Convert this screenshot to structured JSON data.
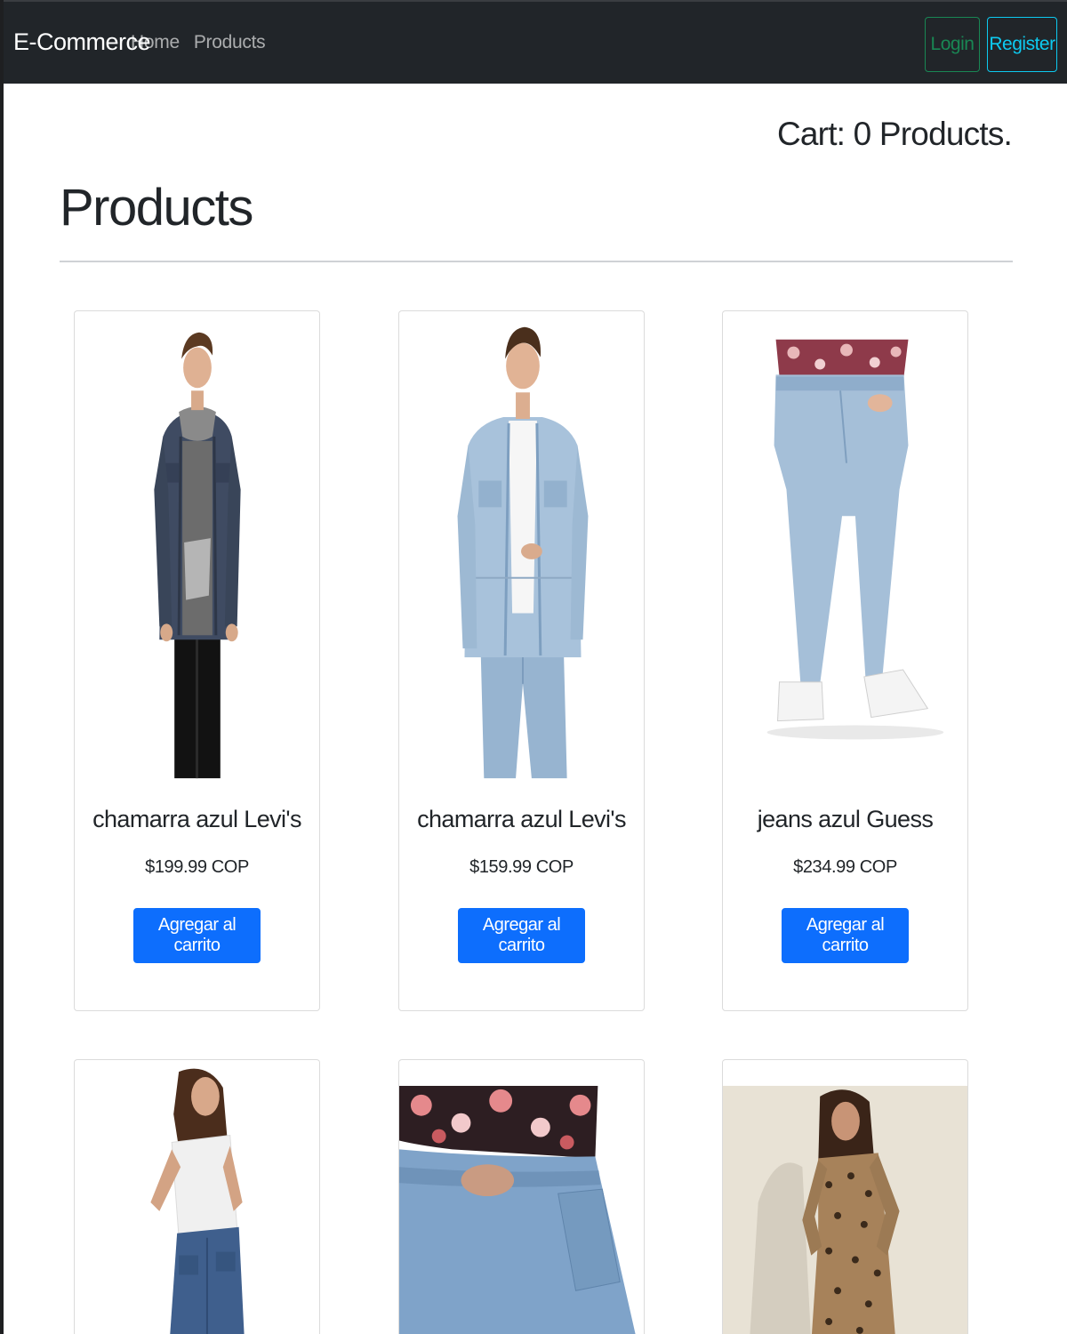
{
  "navbar": {
    "brand": "E-Commerce",
    "links": [
      "Home",
      "Products"
    ],
    "login_label": "Login",
    "register_label": "Register"
  },
  "cart": {
    "text": "Cart: 0 Products."
  },
  "page": {
    "title": "Products"
  },
  "products": [
    {
      "name": "chamarra azul Levi's",
      "price": "$199.99 COP",
      "button": "Agregar al carrito",
      "image": "man in dark denim jacket with hoodie"
    },
    {
      "name": "chamarra azul Levi's",
      "price": "$159.99 COP",
      "button": "Agregar al carrito",
      "image": "man in light blue denim jacket and jeans"
    },
    {
      "name": "jeans azul Guess",
      "price": "$234.99 COP",
      "button": "Agregar al carrito",
      "image": "light blue skinny jeans with white sneakers"
    },
    {
      "image": "woman in white top and blue jeans, back view"
    },
    {
      "image": "close-up of jeans pocket with floral top"
    },
    {
      "image": "woman in leopard print dress"
    }
  ],
  "colors": {
    "navbar_bg": "#212529",
    "login": "#198754",
    "register": "#0dcaf0",
    "primary_button": "#0d6efd"
  }
}
